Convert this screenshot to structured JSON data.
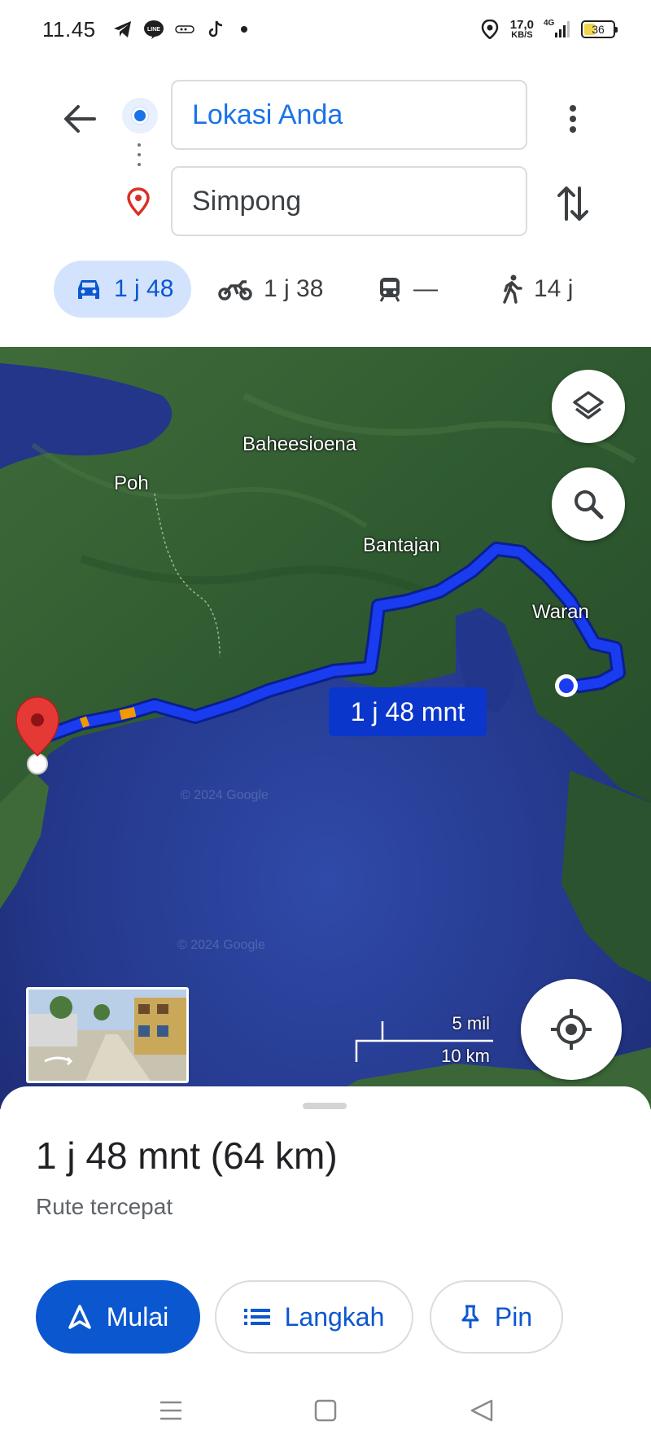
{
  "status_bar": {
    "time": "11.45",
    "net_speed_value": "17,0",
    "net_speed_unit": "KB/S",
    "network": "4G",
    "battery": "36",
    "battery_level": 0.36,
    "icons": [
      "telegram-icon",
      "line-icon",
      "dana-icon",
      "tiktok-icon",
      "notification-dot",
      "location-icon",
      "signal-icon",
      "battery-icon"
    ]
  },
  "directions": {
    "origin": "Lokasi Anda",
    "destination": "Simpong"
  },
  "modes": [
    {
      "name": "car",
      "label": "1 j 48",
      "active": true
    },
    {
      "name": "motorcycle",
      "label": "1 j 38",
      "active": false
    },
    {
      "name": "transit",
      "label": "—",
      "active": false
    },
    {
      "name": "walk",
      "label": "14 j",
      "active": false
    }
  ],
  "map": {
    "labels": {
      "baheesioena": "Baheesioena",
      "poh": "Poh",
      "bantajan": "Bantajan",
      "waran": "Waran"
    },
    "route_badge": "1 j 48 mnt",
    "watermark": "© 2024 Google",
    "scale_mi": "5 mil",
    "scale_km": "10 km",
    "route_color": "#1a3cf0",
    "traffic_color": "#f29900"
  },
  "sheet": {
    "summary": "1 j 48 mnt (64 km)",
    "description": "Rute tercepat",
    "start_label": "Mulai",
    "steps_label": "Langkah",
    "pin_label": "Pin"
  },
  "colors": {
    "accent": "#0b57d0",
    "active_mode_bg": "#d3e3fd",
    "destination_pin": "#d93025"
  }
}
